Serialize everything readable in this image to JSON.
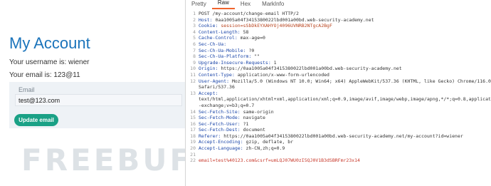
{
  "left": {
    "page_title": "My Account",
    "username_text": "Your username is: wiener",
    "email_text": "Your email is: 123@11",
    "email_label": "Email",
    "email_value": "test@123.com",
    "update_button": "Update email",
    "watermark": "FREEBUF"
  },
  "viewer": {
    "tabs": [
      "Pretty",
      "Raw",
      "Hex",
      "MarkInfo"
    ],
    "active_tab": "Raw",
    "lines": [
      {
        "n": "1",
        "name": "",
        "value": "POST /my-account/change-email HTTP/2"
      },
      {
        "n": "2",
        "name": "Host:",
        "value": " 0aa1005a04f3415380022lbd001a00bd.web-security-academy.net"
      },
      {
        "n": "3",
        "name": "Cookie:",
        "value": " session=sSbDkEYXAHYOj4096UVNRB2NTgcA2BgF"
      },
      {
        "n": "4",
        "name": "Content-Length:",
        "value": " 58"
      },
      {
        "n": "5",
        "name": "Cache-Control:",
        "value": " max-age=0"
      },
      {
        "n": "6",
        "name": "Sec-Ch-Ua:",
        "value": ""
      },
      {
        "n": "7",
        "name": "Sec-Ch-Ua-Mobile:",
        "value": " ?0"
      },
      {
        "n": "8",
        "name": "Sec-Ch-Ua-Platform:",
        "value": " \"\""
      },
      {
        "n": "9",
        "name": "Upgrade-Insecure-Requests:",
        "value": " 1"
      },
      {
        "n": "10",
        "name": "Origin:",
        "value": " https://0aa1005a04f3415380022lbd001a00bd.web-security-academy.net"
      },
      {
        "n": "11",
        "name": "Content-Type:",
        "value": " application/x-www-form-urlencoded"
      },
      {
        "n": "12",
        "name": "User-Agent:",
        "value": " Mozilla/5.0 (Windows NT 10.0; Win64; x64) AppleWebKit/537.36 (KHTML, like Gecko) Chrome/116.0.5845"
      },
      {
        "n": "",
        "name": "",
        "value": "Safari/537.36"
      },
      {
        "n": "13",
        "name": "Accept:",
        "value": ""
      },
      {
        "n": "",
        "name": "",
        "value": "text/html,application/xhtml+xml,application/xml;q=0.9,image/avif,image/webp,image/apng,*/*;q=0.8,application/s"
      },
      {
        "n": "",
        "name": "",
        "value": "-exchange;v=b3;q=0.7"
      },
      {
        "n": "14",
        "name": "Sec-Fetch-Site:",
        "value": " same-origin"
      },
      {
        "n": "15",
        "name": "Sec-Fetch-Mode:",
        "value": " navigate"
      },
      {
        "n": "16",
        "name": "Sec-Fetch-User:",
        "value": " ?1"
      },
      {
        "n": "17",
        "name": "Sec-Fetch-Dest:",
        "value": " document"
      },
      {
        "n": "18",
        "name": "Referer:",
        "value": " https://0aa1005a04f3415380022lbd001a00bd.web-security-academy.net/my-account?id=wiener"
      },
      {
        "n": "19",
        "name": "Accept-Encoding:",
        "value": " gzip, deflate, br"
      },
      {
        "n": "20",
        "name": "Accept-Language:",
        "value": " zh-CN,zh;q=0.9"
      },
      {
        "n": "21",
        "name": "",
        "value": ""
      },
      {
        "n": "22",
        "name": "",
        "value": "email=test%40123.com&csrf=umLQJ07WU0zI5QJ0V1B3dSBRFmr23x14"
      }
    ]
  },
  "colors": {
    "title_blue": "#1b74bb",
    "button_green": "#1aa186",
    "active_tab_orange": "#f0642d",
    "header_blue": "#1a45a8",
    "body_red": "#c8392b"
  }
}
